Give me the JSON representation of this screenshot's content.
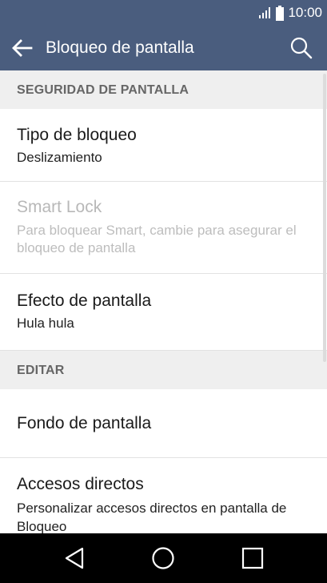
{
  "status_bar": {
    "time": "10:00",
    "icons": [
      "signal-icon",
      "battery-icon"
    ]
  },
  "toolbar": {
    "title": "Bloqueo de pantalla",
    "back_icon": "arrow-left-icon",
    "search_icon": "search-icon"
  },
  "sections": [
    {
      "header": "SEGURIDAD DE PANTALLA",
      "items": [
        {
          "title": "Tipo de bloqueo",
          "subtitle": "Deslizamiento",
          "enabled": true
        },
        {
          "title": "Smart Lock",
          "subtitle": "Para bloquear Smart, cambie para asegurar el bloqueo de pantalla",
          "enabled": false
        },
        {
          "title": "Efecto de pantalla",
          "subtitle": "Hula hula",
          "enabled": true
        }
      ]
    },
    {
      "header": "EDITAR",
      "items": [
        {
          "title": "Fondo de pantalla",
          "enabled": true
        },
        {
          "title": "Accesos directos",
          "subtitle": "Personalizar accesos directos en pantalla de Bloqueo",
          "enabled": true
        }
      ]
    }
  ],
  "nav_bar": {
    "icons": [
      "nav-back-icon",
      "nav-home-icon",
      "nav-recents-icon"
    ]
  },
  "colors": {
    "toolbar": "#4a5d7e",
    "section_header_bg": "#efefef",
    "section_header_text": "#666666",
    "disabled_text": "#b8b8b8"
  }
}
